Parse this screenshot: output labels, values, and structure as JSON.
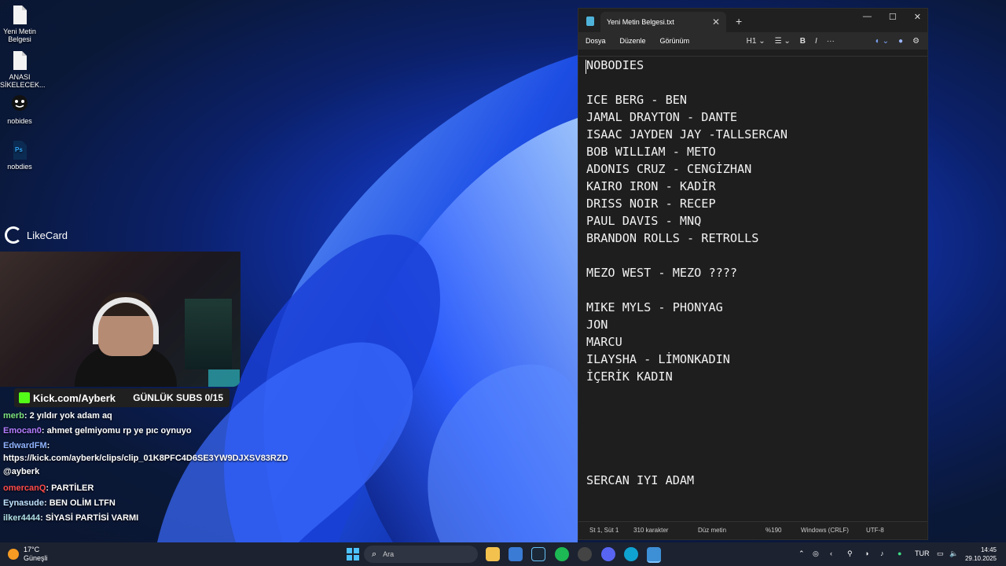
{
  "desktop": {
    "icons": [
      {
        "label": "Yeni Metin Belgesi",
        "icon": "text-file-icon"
      },
      {
        "label": "ANASI SİKELECEK...",
        "icon": "text-file-icon"
      },
      {
        "label": "nobides",
        "icon": "smiley-face-icon"
      },
      {
        "label": "nobdies",
        "icon": "photoshop-file-icon"
      }
    ]
  },
  "stream": {
    "sponsor": "LikeCard",
    "kick_url": "Kick.com/Ayberk",
    "subs_label": "GÜNLÜK SUBS 0/15",
    "chat": [
      {
        "user": "merb",
        "user_color": "#7de37d",
        "text": ": 2 yıldır yok adam aq"
      },
      {
        "user": "Emocan0",
        "user_color": "#b57cff",
        "text": ": ahmet gelmiyomu rp ye pıc oynuyo"
      },
      {
        "user": "EdwardFM",
        "user_color": "#8fb3ff",
        "text": ":"
      },
      {
        "user": "",
        "user_color": "#ffffff",
        "text": "https://kick.com/ayberk/clips/clip_01K8PFC4D6SE3YW9DJXSV83RZD @ayberk"
      },
      {
        "user": "omercanQ",
        "user_color": "#ff4b4b",
        "text": ": PARTİLER"
      },
      {
        "user": "Eynasude",
        "user_color": "#bfe3ff",
        "text": ": BEN OLİM LTFN"
      },
      {
        "user": "ilker4444",
        "user_color": "#b0e0e6",
        "text": ": SİYASİ PARTİSİ VARMI"
      }
    ]
  },
  "notepad": {
    "tab_title": "Yeni Metin Belgesi.txt",
    "menu": [
      "Dosya",
      "Düzenle",
      "Görünüm"
    ],
    "heading_select": "H1",
    "lines": [
      {
        "text": "NOBODIES",
        "row": 0
      },
      {
        "text": "ICE BERG - BEN",
        "row": 2
      },
      {
        "text": "JAMAL DRAYTON - DANTE",
        "row": 3
      },
      {
        "text": "ISAAC JAYDEN JAY -TALLSERCAN",
        "row": 4
      },
      {
        "text": "BOB WILLIAM - METO",
        "row": 5
      },
      {
        "text": "ADONIS CRUZ - CENGİZHAN",
        "row": 6
      },
      {
        "text": "KAIRO IRON - KADİR",
        "row": 7
      },
      {
        "text": "DRISS NOIR - RECEP",
        "row": 8
      },
      {
        "text": "PAUL DAVIS - MNQ",
        "row": 9
      },
      {
        "text": "BRANDON ROLLS - RETROLLS",
        "row": 10
      },
      {
        "text": "MEZO WEST - MEZO ????",
        "row": 12
      },
      {
        "text": "MIKE MYLS - PHONYAG",
        "row": 14
      },
      {
        "text": "JON",
        "row": 15
      },
      {
        "text": "MARCU",
        "row": 16
      },
      {
        "text": "ILAYSHA - LİMONKADIN",
        "row": 17
      },
      {
        "text": "İÇERİK KADIN",
        "row": 18
      },
      {
        "text": "SERCAN IYI ADAM",
        "row": 24
      }
    ],
    "status": {
      "position": "St 1, Süt 1",
      "chars": "310 karakter",
      "format": "Düz metin",
      "zoom": "%190",
      "line_ending": "Windows (CRLF)",
      "encoding": "UTF-8"
    }
  },
  "taskbar": {
    "weather_temp": "17°C",
    "weather_desc": "Güneşli",
    "search_placeholder": "Ara",
    "language": "TUR",
    "time": "14:45",
    "date": "29.10.2025"
  }
}
